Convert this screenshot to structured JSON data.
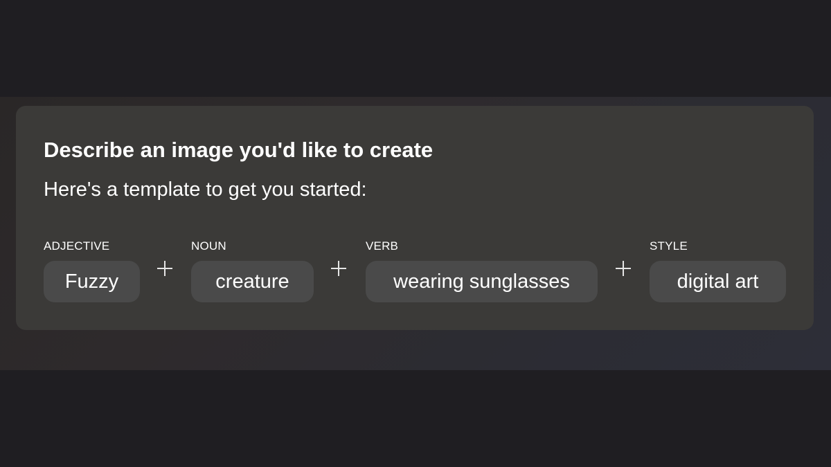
{
  "prompt_card": {
    "title": "Describe an image you'd like to create",
    "subtitle": "Here's a template to get you started:",
    "slots": [
      {
        "label": "ADJECTIVE",
        "value": "Fuzzy"
      },
      {
        "label": "NOUN",
        "value": "creature"
      },
      {
        "label": "VERB",
        "value": "wearing sunglasses"
      },
      {
        "label": "STYLE",
        "value": "digital art"
      }
    ],
    "separator_icon": "plus-icon"
  },
  "colors": {
    "page_background": "#1f1e22",
    "card_background": "#3b3a38",
    "pill_background": "#4a4a4a",
    "text": "#ffffff"
  }
}
